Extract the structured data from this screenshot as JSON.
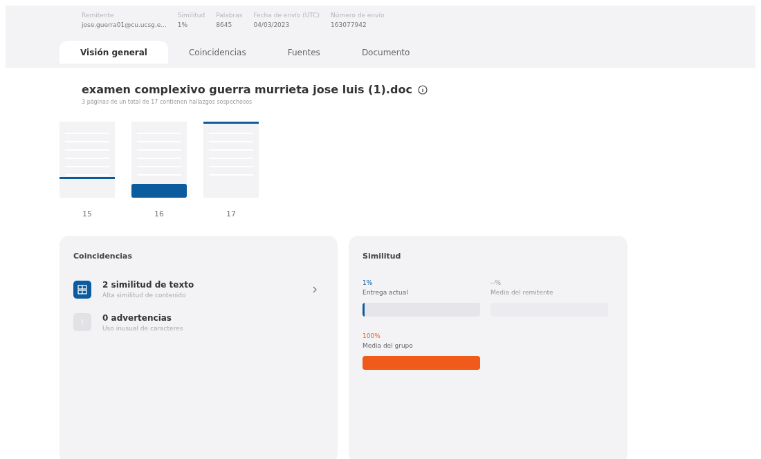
{
  "header": {
    "fields": [
      {
        "label": "Remitente",
        "value": "jose.guerra01@cu.ucsg.e..."
      },
      {
        "label": "Similitud",
        "value": "1%"
      },
      {
        "label": "Palabras",
        "value": "8645"
      },
      {
        "label": "Fecha de envío (UTC)",
        "value": "04/03/2023"
      },
      {
        "label": "Número de envío",
        "value": "163077942"
      }
    ]
  },
  "tabs": [
    {
      "label": "Visión general",
      "selected": true
    },
    {
      "label": "Coincidencias",
      "selected": false
    },
    {
      "label": "Fuentes",
      "selected": false
    },
    {
      "label": "Documento",
      "selected": false
    }
  ],
  "document": {
    "title": "examen complexivo guerra murrieta jose luis (1).doc",
    "subtitle": "3 páginas de un total de 17 contienen hallazgos sospechosos"
  },
  "pages": [
    {
      "number": "15",
      "kind": "lowline"
    },
    {
      "number": "16",
      "kind": "block"
    },
    {
      "number": "17",
      "kind": "topline"
    }
  ],
  "matches_card": {
    "title": "Coincidencias",
    "items": [
      {
        "title": "2 similitud de texto",
        "subtitle": "Alta similitud de contenido",
        "disabled": false
      },
      {
        "title": "0 advertencias",
        "subtitle": "Uso inusual de caracteres",
        "disabled": true
      }
    ]
  },
  "similarity_card": {
    "title": "Similitud",
    "metrics": [
      {
        "reading": "1%",
        "label": "Entrega actual",
        "level": 0.01,
        "color": "#0b5c9e",
        "disabled": false
      },
      {
        "reading": "--%",
        "label": "Media del remitente",
        "disabled": true
      },
      {
        "reading": "100%",
        "label": "Media del grupo",
        "level": 1,
        "color": "#f05a1a",
        "disabled": false
      }
    ]
  }
}
